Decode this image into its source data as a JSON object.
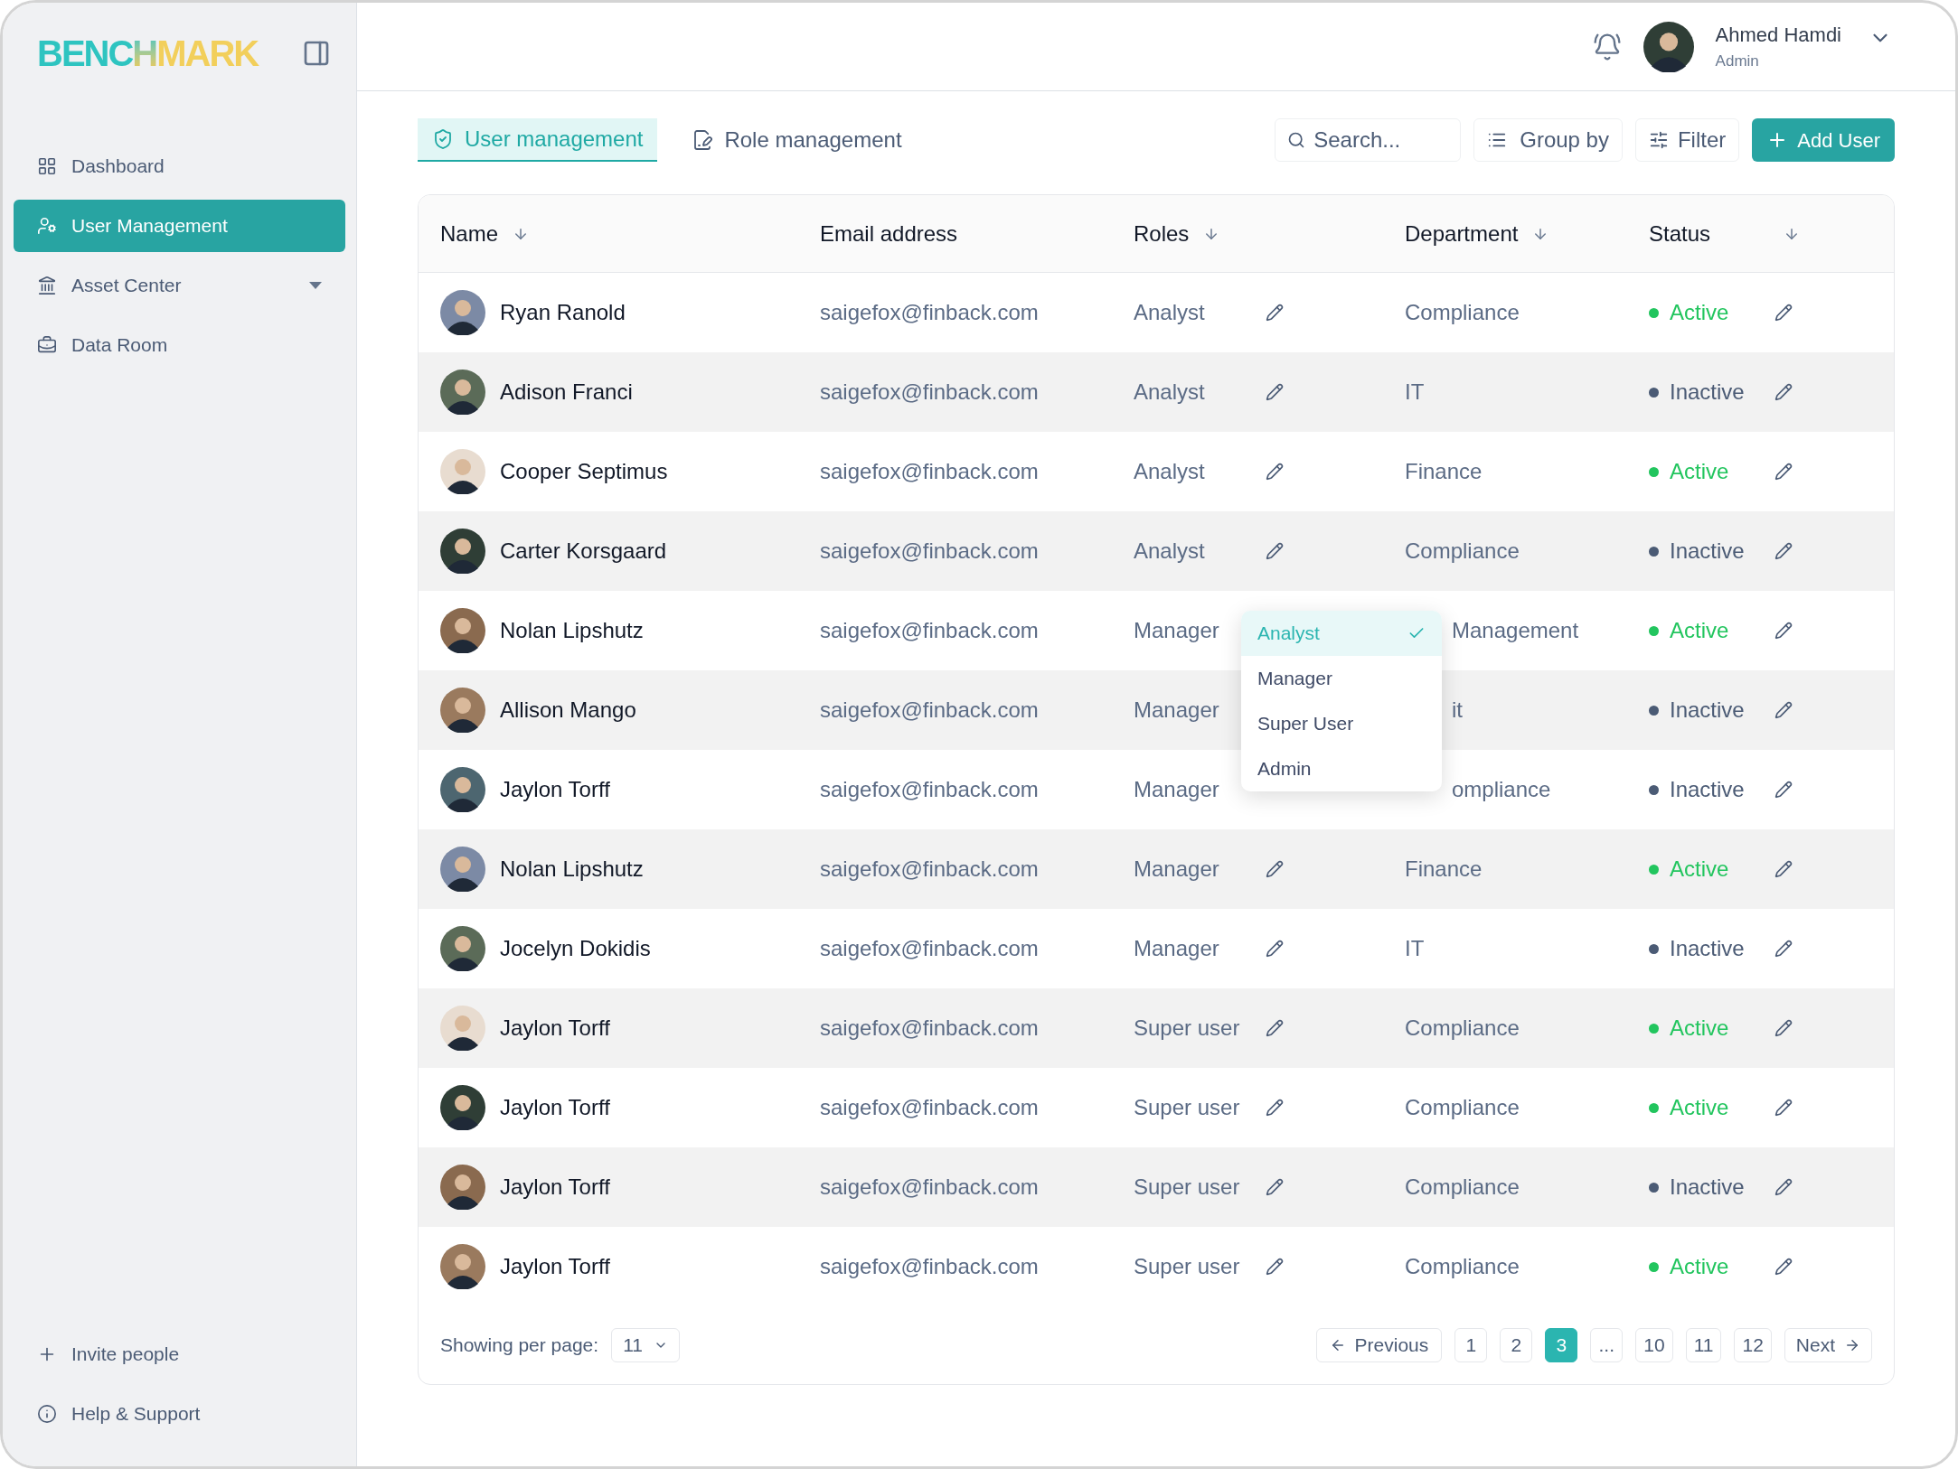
{
  "logo": {
    "left": "BENC",
    "middle": "H",
    "right": "MARK"
  },
  "sidebar": {
    "items": [
      {
        "label": "Dashboard",
        "selected": false,
        "expandable": false
      },
      {
        "label": "User Management",
        "selected": true,
        "expandable": false
      },
      {
        "label": "Asset Center",
        "selected": false,
        "expandable": true
      },
      {
        "label": "Data Room",
        "selected": false,
        "expandable": false
      }
    ],
    "footer": [
      {
        "label": "Invite people"
      },
      {
        "label": "Help & Support"
      }
    ]
  },
  "header": {
    "user": {
      "name": "Ahmed Hamdi",
      "role": "Admin"
    }
  },
  "tabs": [
    {
      "label": "User management",
      "selected": true
    },
    {
      "label": "Role management",
      "selected": false
    }
  ],
  "toolbar": {
    "search": {
      "placeholder": "Search..."
    },
    "group_by": "Group by",
    "filter": "Filter",
    "add": "Add User"
  },
  "table": {
    "columns": [
      {
        "label": "Name",
        "sortable": true
      },
      {
        "label": "Email address",
        "sortable": false
      },
      {
        "label": "Roles",
        "sortable": true
      },
      {
        "label": "Department",
        "sortable": true
      },
      {
        "label": "Status",
        "sortable": true
      }
    ],
    "rows": [
      {
        "name": "Ryan Ranold",
        "email": "saigefox@finback.com",
        "role": "Analyst",
        "department": "Compliance",
        "status": "Active",
        "active": true
      },
      {
        "name": "Adison Franci",
        "email": "saigefox@finback.com",
        "role": "Analyst",
        "department": "IT",
        "status": "Inactive",
        "active": false
      },
      {
        "name": "Cooper Septimus",
        "email": "saigefox@finback.com",
        "role": "Analyst",
        "department": "Finance",
        "status": "Active",
        "active": true
      },
      {
        "name": "Carter Korsgaard",
        "email": "saigefox@finback.com",
        "role": "Analyst",
        "department": "Compliance",
        "status": "Inactive",
        "active": false
      },
      {
        "name": "Nolan Lipshutz",
        "email": "saigefox@finback.com",
        "role": "Manager",
        "department": "Management",
        "status": "Active",
        "active": true,
        "role_menu_open": true
      },
      {
        "name": "Allison Mango",
        "email": "saigefox@finback.com",
        "role": "Manager",
        "department": "it",
        "status": "Inactive",
        "active": false
      },
      {
        "name": "Jaylon Torff",
        "email": "saigefox@finback.com",
        "role": "Manager",
        "department": "ompliance",
        "status": "Inactive",
        "active": false
      },
      {
        "name": "Nolan Lipshutz",
        "email": "saigefox@finback.com",
        "role": "Manager",
        "department": "Finance",
        "status": "Active",
        "active": true
      },
      {
        "name": "Jocelyn Dokidis",
        "email": "saigefox@finback.com",
        "role": "Manager",
        "department": "IT",
        "status": "Inactive",
        "active": false
      },
      {
        "name": "Jaylon Torff",
        "email": "saigefox@finback.com",
        "role": "Super user",
        "department": "Compliance",
        "status": "Active",
        "active": true
      },
      {
        "name": "Jaylon Torff",
        "email": "saigefox@finback.com",
        "role": "Super user",
        "department": "Compliance",
        "status": "Active",
        "active": true
      },
      {
        "name": "Jaylon Torff",
        "email": "saigefox@finback.com",
        "role": "Super user",
        "department": "Compliance",
        "status": "Inactive",
        "active": false
      },
      {
        "name": "Jaylon Torff",
        "email": "saigefox@finback.com",
        "role": "Super user",
        "department": "Compliance",
        "status": "Active",
        "active": true
      }
    ]
  },
  "role_menu": {
    "options": [
      {
        "label": "Analyst",
        "selected": true
      },
      {
        "label": "Manager",
        "selected": false
      },
      {
        "label": "Super User",
        "selected": false
      },
      {
        "label": "Admin",
        "selected": false
      }
    ]
  },
  "pagination": {
    "per_page_label": "Showing per page:",
    "per_page": "11",
    "previous": "Previous",
    "next": "Next",
    "pages": [
      {
        "label": "1",
        "selected": false
      },
      {
        "label": "2",
        "selected": false
      },
      {
        "label": "3",
        "selected": true
      },
      {
        "label": "...",
        "selected": false
      },
      {
        "label": "10",
        "selected": false
      },
      {
        "label": "11",
        "selected": false
      },
      {
        "label": "12",
        "selected": false
      }
    ]
  }
}
